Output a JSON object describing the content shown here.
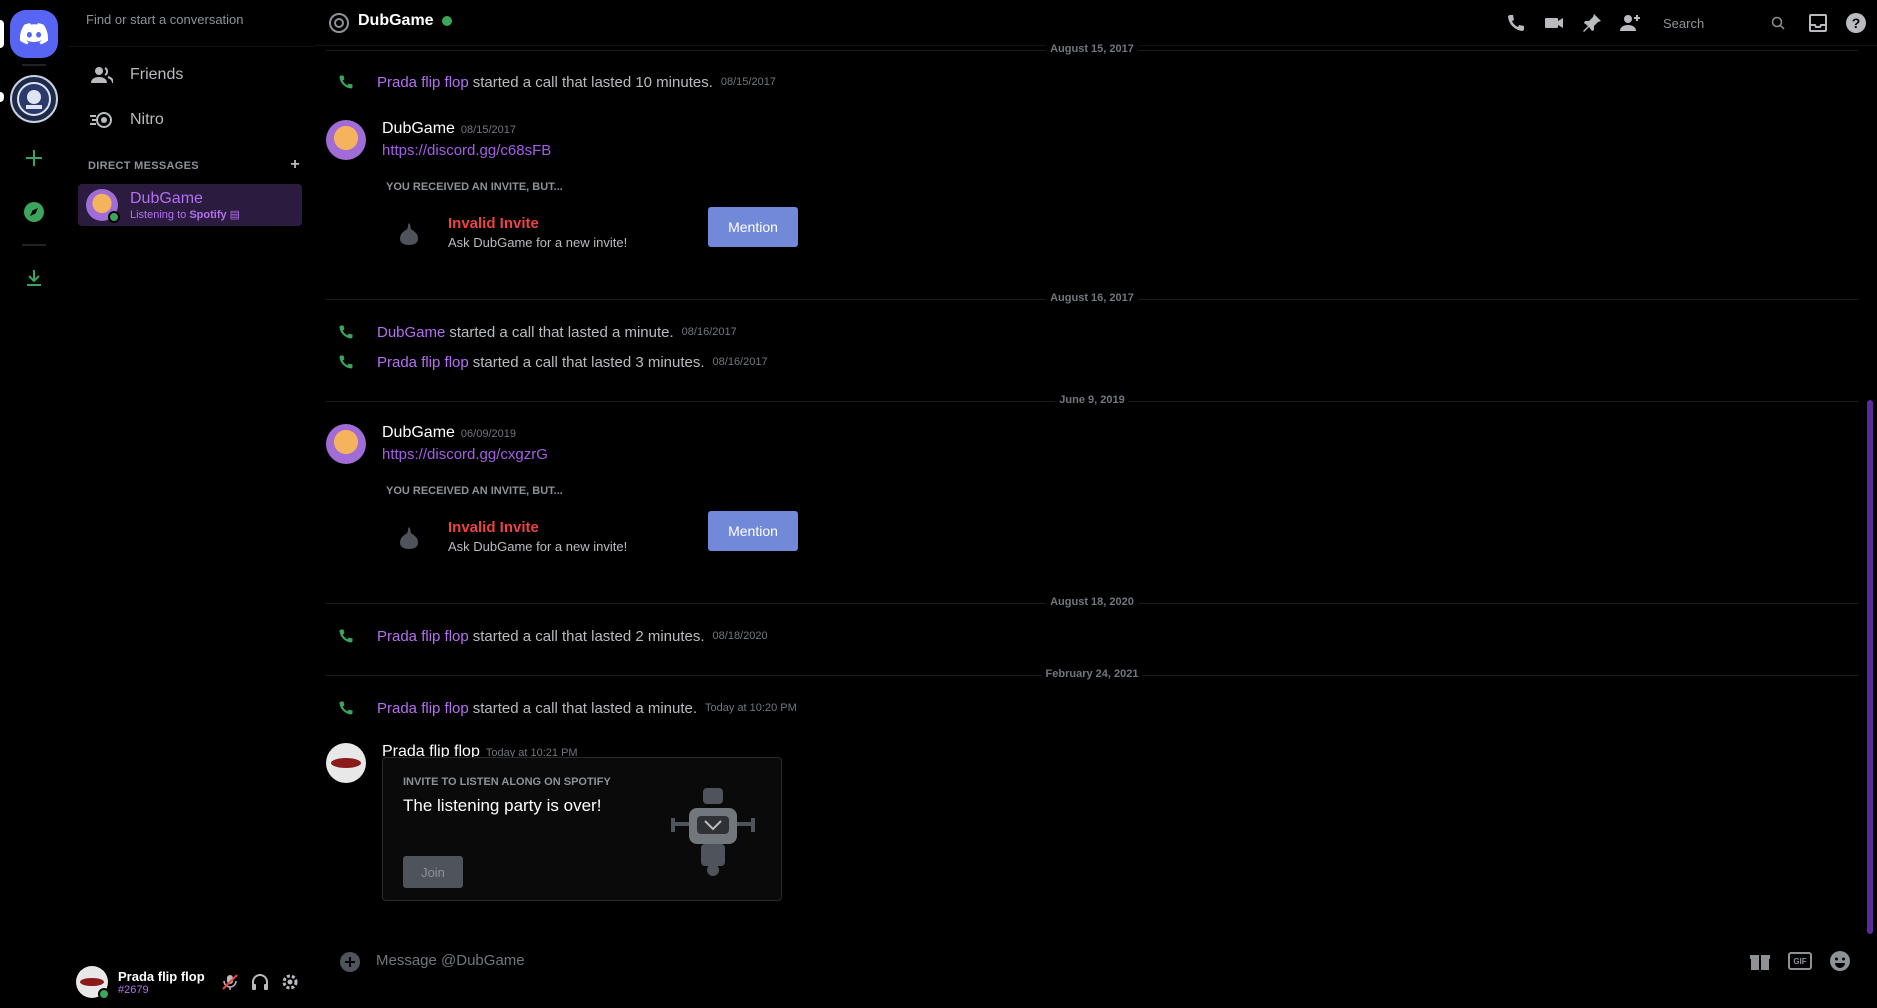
{
  "sidebar": {
    "search_placeholder": "Find or start a conversation",
    "nav": [
      {
        "label": "Friends",
        "icon": "friends-icon"
      },
      {
        "label": "Nitro",
        "icon": "nitro-icon"
      }
    ],
    "dm_header": "DIRECT MESSAGES",
    "dm_items": [
      {
        "name": "DubGame",
        "status_prefix": "Listening to ",
        "status_app": "Spotify"
      }
    ],
    "user": {
      "name": "Prada flip flop",
      "tag": "#2679"
    }
  },
  "header": {
    "channel_name": "DubGame",
    "search_placeholder": "Search"
  },
  "dividers": [
    "August 15, 2017",
    "August 16, 2017",
    "June 9, 2019",
    "August 18, 2020",
    "February 24, 2021"
  ],
  "messages": {
    "call1": {
      "who": "Prada flip flop",
      "what": "started a call that lasted 10 minutes.",
      "when": "08/15/2017"
    },
    "msg1": {
      "author": "DubGame",
      "time": "08/15/2017",
      "link": "https://discord.gg/c68sFB"
    },
    "invite1": {
      "head": "YOU RECEIVED AN INVITE, BUT...",
      "title": "Invalid Invite",
      "sub": "Ask DubGame for a new invite!",
      "button": "Mention"
    },
    "call2": {
      "who": "DubGame",
      "what": "started a call that lasted a minute.",
      "when": "08/16/2017"
    },
    "call3": {
      "who": "Prada flip flop",
      "what": "started a call that lasted 3 minutes.",
      "when": "08/16/2017"
    },
    "msg2": {
      "author": "DubGame",
      "time": "06/09/2019",
      "link": "https://discord.gg/cxgzrG"
    },
    "invite2": {
      "head": "YOU RECEIVED AN INVITE, BUT...",
      "title": "Invalid Invite",
      "sub": "Ask DubGame for a new invite!",
      "button": "Mention"
    },
    "call4": {
      "who": "Prada flip flop",
      "what": "started a call that lasted 2 minutes.",
      "when": "08/18/2020"
    },
    "call5": {
      "who": "Prada flip flop",
      "what": "started a call that lasted a minute.",
      "when": "Today at 10:20 PM"
    },
    "msg3": {
      "author": "Prada flip flop",
      "time": "Today at 10:21 PM"
    },
    "spotify": {
      "head": "INVITE TO LISTEN ALONG ON SPOTIFY",
      "title": "The listening party is over!",
      "button": "Join"
    }
  },
  "composer": {
    "placeholder": "Message @DubGame",
    "gif_label": "GIF"
  },
  "colors": {
    "accent": "#5865f2",
    "username": "#b46ef0",
    "online": "#3ba55d",
    "danger": "#ed4245",
    "mention": "#7289da",
    "call": "#3ba55d"
  }
}
